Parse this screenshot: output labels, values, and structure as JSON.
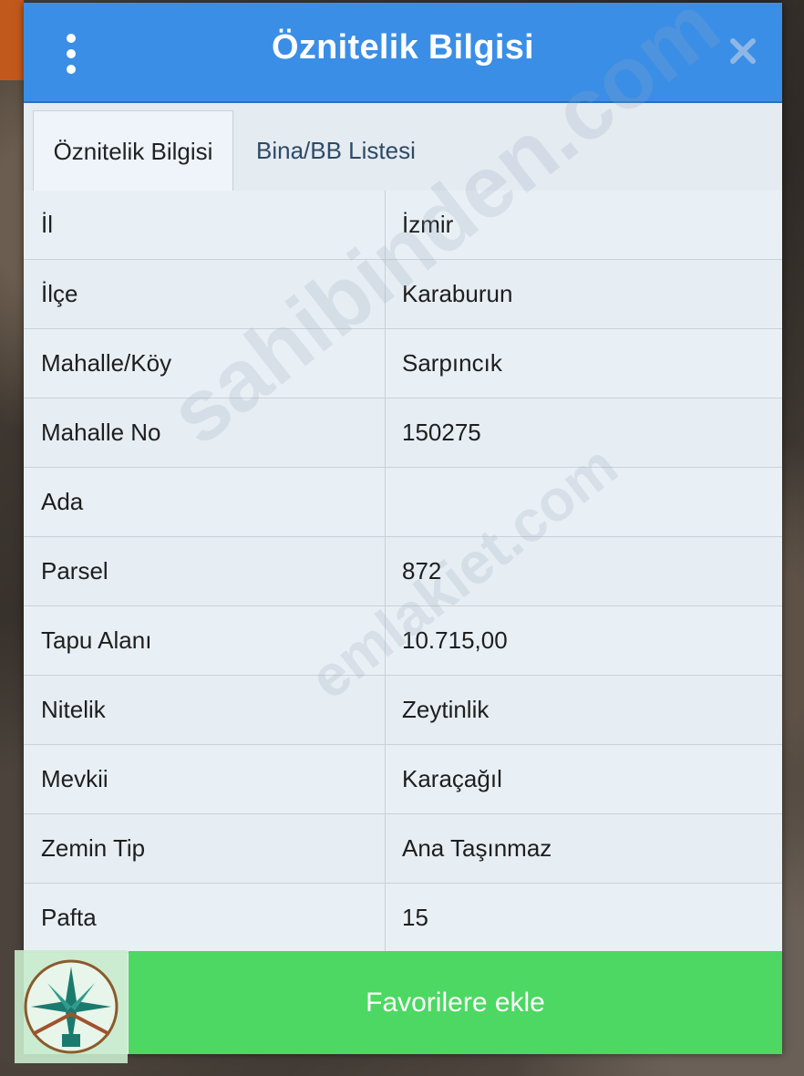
{
  "header": {
    "title": "Öznitelik Bilgisi",
    "menu_icon": "more-vertical-icon",
    "close_icon": "close-icon",
    "color": "#3a8ee6"
  },
  "tabs": [
    {
      "label": "Öznitelik Bilgisi",
      "active": true
    },
    {
      "label": "Bina/BB Listesi",
      "active": false
    }
  ],
  "attributes": [
    {
      "key": "İl",
      "value": "İzmir"
    },
    {
      "key": "İlçe",
      "value": "Karaburun"
    },
    {
      "key": "Mahalle/Köy",
      "value": "Sarpıncık"
    },
    {
      "key": "Mahalle No",
      "value": "150275"
    },
    {
      "key": "Ada",
      "value": ""
    },
    {
      "key": "Parsel",
      "value": "872"
    },
    {
      "key": "Tapu Alanı",
      "value": "10.715,00"
    },
    {
      "key": "Nitelik",
      "value": "Zeytinlik"
    },
    {
      "key": "Mevkii",
      "value": "Karaçağıl"
    },
    {
      "key": "Zemin Tip",
      "value": "Ana Taşınmaz"
    },
    {
      "key": "Pafta",
      "value": "15"
    }
  ],
  "footer": {
    "button_label": "Favorilere ekle",
    "button_color": "#4cd862"
  },
  "watermark": {
    "line1": "sahibinden.com",
    "line2": "emlakiet.com"
  }
}
